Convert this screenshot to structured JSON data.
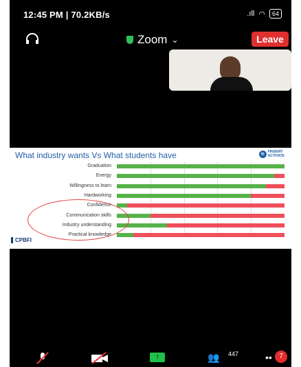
{
  "status_bar": {
    "left_text": "12:45 PM | 70.2KB/s",
    "battery": "64"
  },
  "top_bar": {
    "app_title": "Zoom",
    "leave_label": "Leave"
  },
  "slide": {
    "title": "What industry wants Vs What students have",
    "logo_text_1": "FINSERV",
    "logo_text_2": "ACTIVATE",
    "footer_brand": "CPBFI",
    "rows": [
      {
        "label": "Graduation",
        "green_fraction": 1.0
      },
      {
        "label": "Energy",
        "green_fraction": 0.94
      },
      {
        "label": "Willingness to learn",
        "green_fraction": 0.89
      },
      {
        "label": "Hardworking",
        "green_fraction": 0.8
      },
      {
        "label": "Confidence",
        "green_fraction": 0.06
      },
      {
        "label": "Communication skills",
        "green_fraction": 0.2
      },
      {
        "label": "Industry understanding",
        "green_fraction": 0.3
      },
      {
        "label": "Practical knowledge",
        "green_fraction": 0.1
      }
    ]
  },
  "bottom_bar": {
    "participants_count": "447",
    "chat_badge": "7"
  },
  "colors": {
    "green": "#57b24a",
    "red": "#ef4f5a",
    "leave": "#e12f2f",
    "title_blue": "#1f5fa8"
  }
}
